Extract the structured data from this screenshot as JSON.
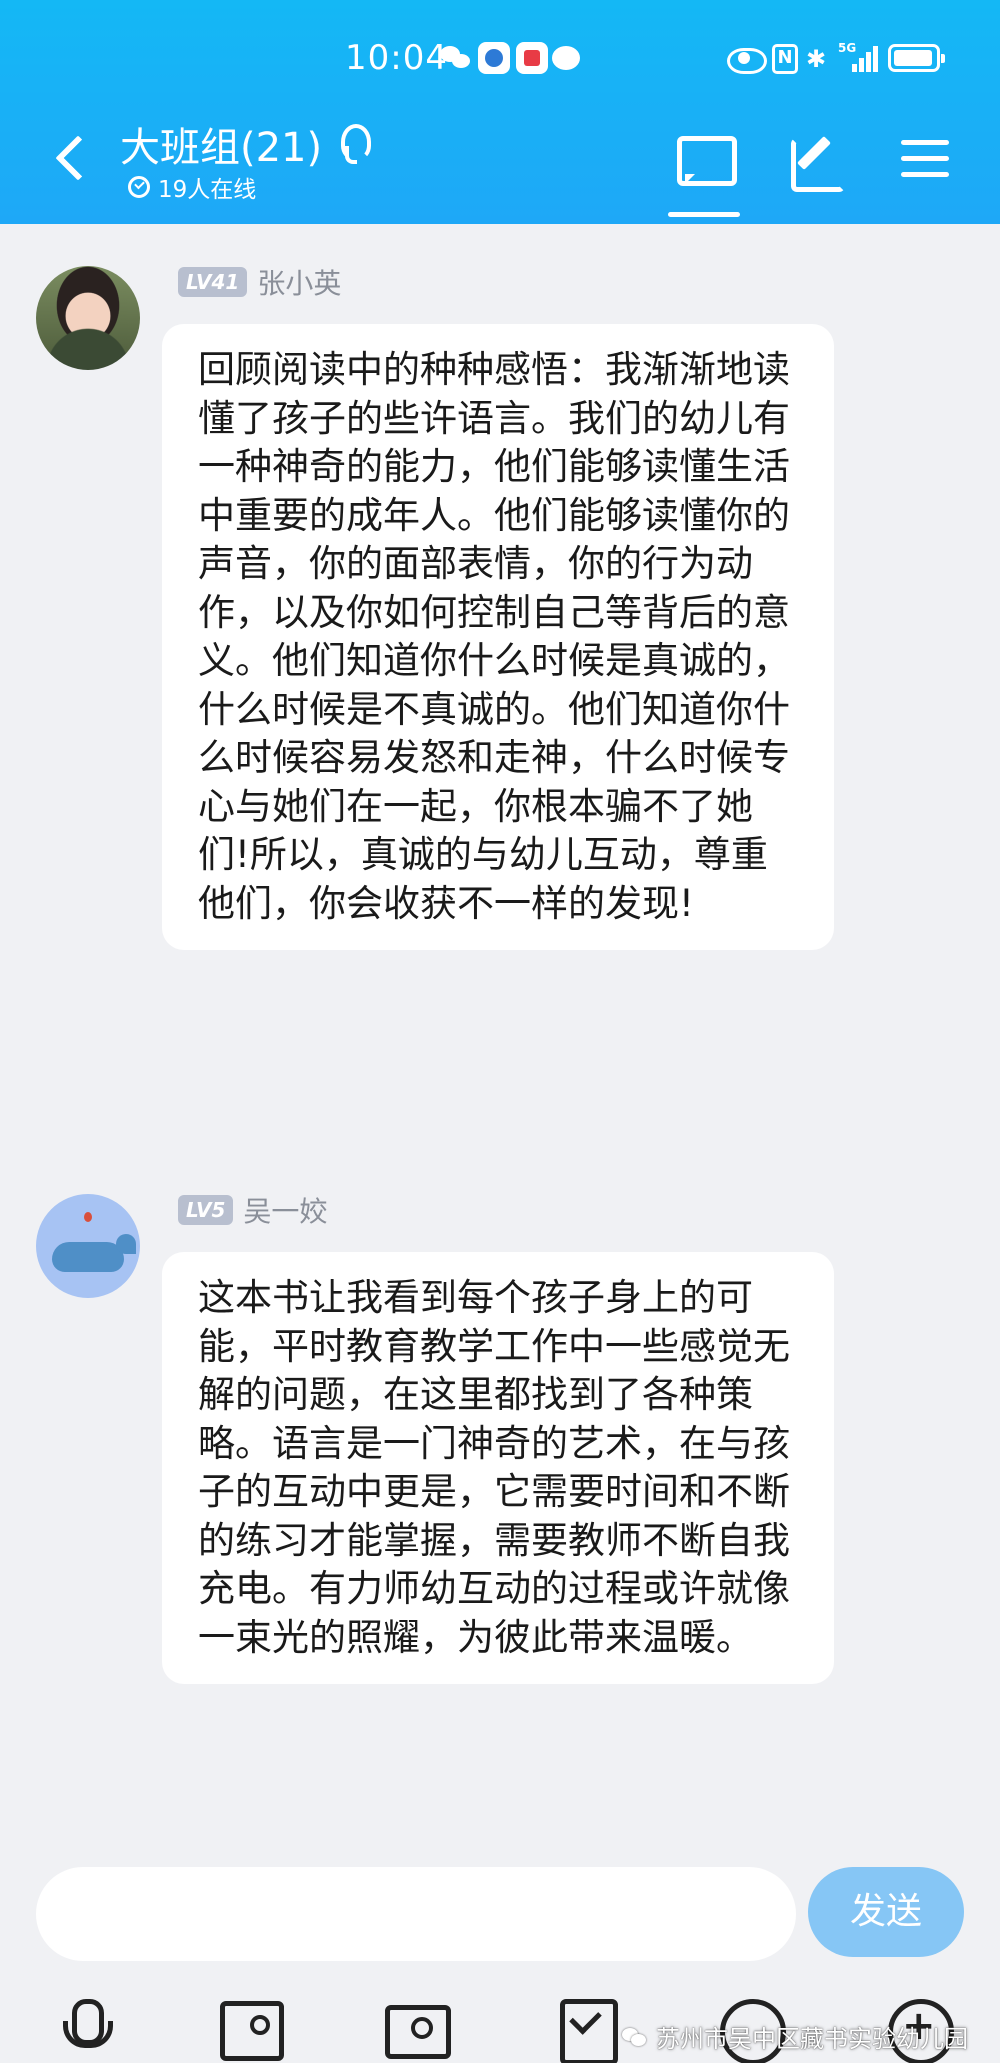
{
  "status_bar": {
    "time": "10:04",
    "icons": [
      "wechat-icon",
      "app-icon",
      "app-icon-red",
      "chat-bubble-icon",
      "eye-icon",
      "nfc-icon",
      "bluetooth-icon",
      "signal-5g-icon",
      "battery-icon"
    ],
    "network": "5G"
  },
  "header": {
    "title": "大班组(21)",
    "online_text": "19人在线",
    "background_color": "#14b8f5",
    "buttons": [
      "back-icon",
      "chat-icon",
      "edit-icon",
      "menu-icon"
    ]
  },
  "messages": [
    {
      "level": "LV41",
      "sender": "张小英",
      "text": "回顾阅读中的种种感悟：我渐渐地读懂了孩子的些许语言。我们的幼儿有一种神奇的能力，他们能够读懂生活中重要的成年人。他们能够读懂你的声音，你的面部表情，你的行为动作，以及你如何控制自己等背后的意义。他们知道你什么时候是真诚的，什么时候是不真诚的。他们知道你什么时候容易发怒和走神，什么时候专心与她们在一起，你根本骗不了她们!所以，真诚的与幼儿互动，尊重他们，你会收获不一样的发现!"
    },
    {
      "level": "LV5",
      "sender": "吴一姣",
      "text": "这本书让我看到每个孩子身上的可能，平时教育教学工作中一些感觉无解的问题，在这里都找到了各种策略。语言是一门神奇的艺术，在与孩子的互动中更是，它需要时间和不断的练习才能掌握，需要教师不断自我充电。有力师幼互动的过程或许就像一束光的照耀，为彼此带来温暖。"
    }
  ],
  "input": {
    "value": "",
    "send_label": "发送",
    "send_color": "#86c6f5"
  },
  "toolbar": {
    "icons": [
      "microphone-icon",
      "image-icon",
      "camera-icon",
      "file-icon",
      "emoji-icon",
      "plus-icon"
    ]
  },
  "watermark": {
    "text": "苏州市吴中区藏书实验幼儿园"
  }
}
